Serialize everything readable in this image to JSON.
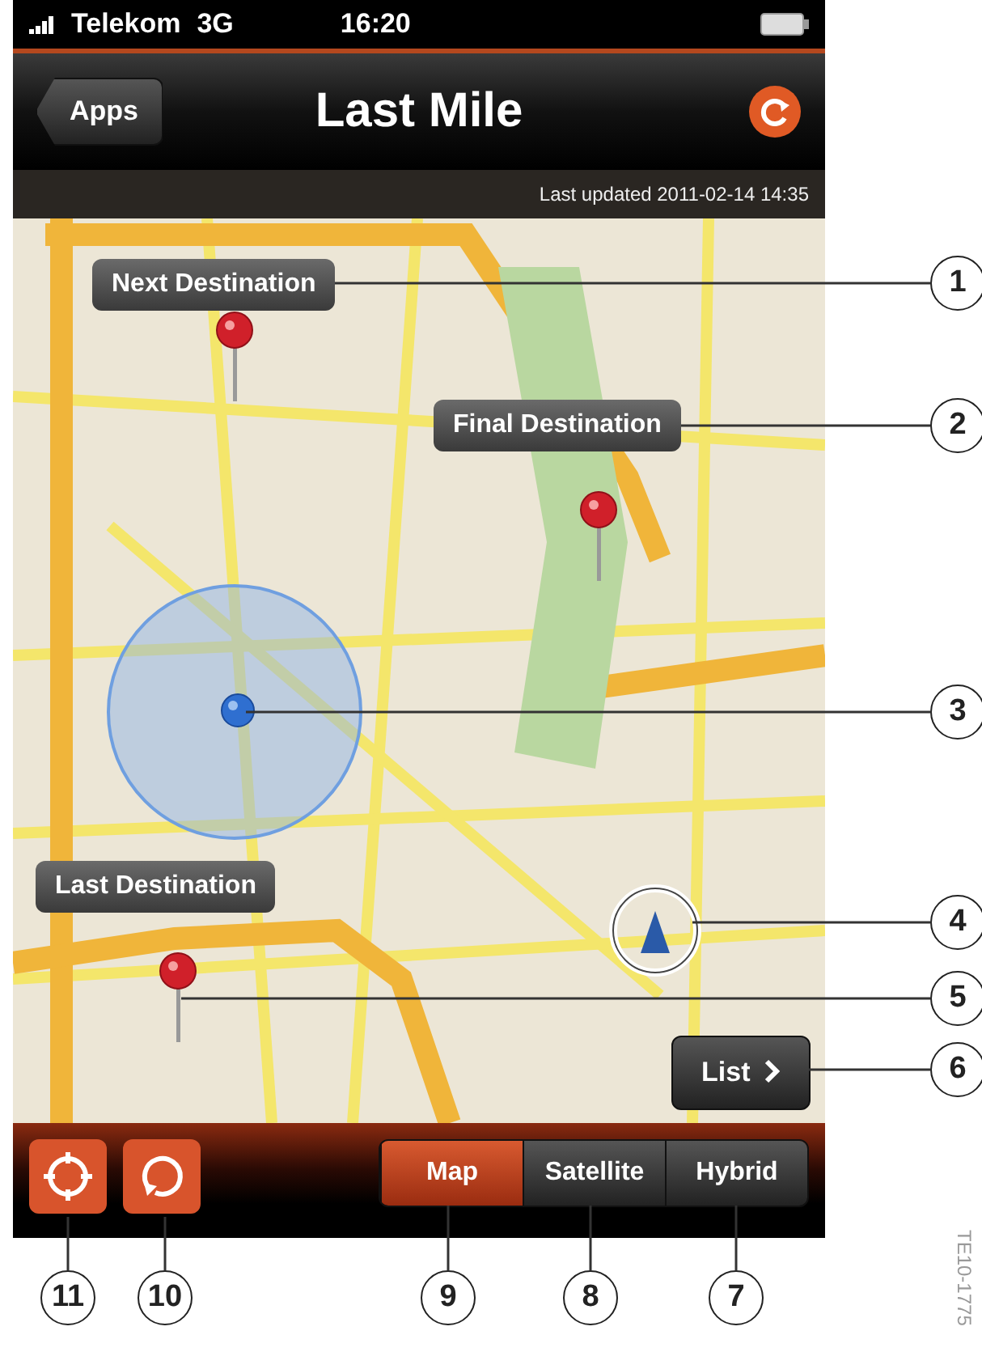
{
  "status_bar": {
    "carrier": "Telekom",
    "network": "3G",
    "time": "16:20"
  },
  "nav_bar": {
    "back_button": "Apps",
    "title": "Last Mile"
  },
  "update_strip": {
    "text": "Last updated 2011-02-14 14:35"
  },
  "map": {
    "callouts": [
      {
        "label": "Next Destination"
      },
      {
        "label": "Final Destination"
      },
      {
        "label": "Last Destination"
      }
    ],
    "list_button": "List"
  },
  "toolbar": {
    "segments": [
      {
        "label": "Map",
        "selected": true
      },
      {
        "label": "Satellite",
        "selected": false
      },
      {
        "label": "Hybrid",
        "selected": false
      }
    ]
  },
  "annotations": [
    "1",
    "2",
    "3",
    "4",
    "5",
    "6",
    "11",
    "10",
    "9",
    "8",
    "7"
  ],
  "figure_id": "TE10-1775"
}
